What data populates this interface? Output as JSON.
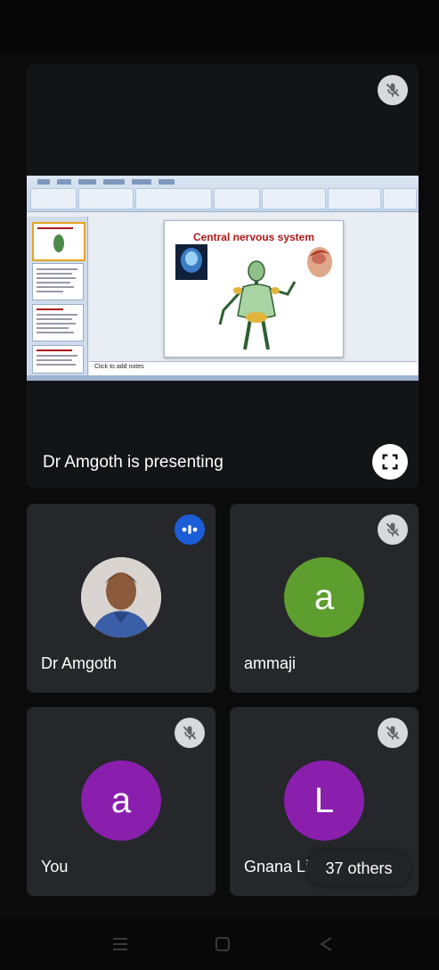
{
  "presentation": {
    "presenter_label": "Dr Amgoth is presenting",
    "slide_title": "Central nervous system",
    "notes_placeholder": "Click to add notes"
  },
  "participants": [
    {
      "name": "Dr Amgoth",
      "state": "speaking"
    },
    {
      "name": "ammaji",
      "initial": "a",
      "color": "#5e9e2e",
      "state": "muted"
    },
    {
      "name": "You",
      "initial": "a",
      "color": "#8a1fae",
      "state": "muted"
    },
    {
      "name": "Gnana Lik",
      "initial": "L",
      "color": "#8a1fae",
      "state": "muted"
    }
  ],
  "others_label": "37 others",
  "colors": {
    "tile_bg": "#25272a",
    "speaking_blue": "#1a5dd6",
    "mute_badge": "#d7d9dc"
  },
  "icons": [
    "mic-off-icon",
    "fullscreen-icon",
    "speaking-icon",
    "recents-icon",
    "home-icon",
    "back-icon"
  ]
}
